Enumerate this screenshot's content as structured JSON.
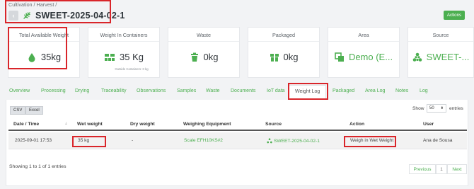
{
  "breadcrumb": "Cultivation / Harvest /",
  "back_icon": "chevron-left-icon",
  "title_icon": "leaf-icon",
  "title": "SWEET-2025-04-02-1",
  "actions_label": "Actions",
  "colors": {
    "accent": "#4caf50",
    "highlight": "#d9252a"
  },
  "cards": [
    {
      "title": "Total Available Weight",
      "value": "35kg",
      "icon": "drop-icon"
    },
    {
      "title": "Weight In Containers",
      "value": "35 Kg",
      "sub": "Outside Containers: 0 kg",
      "icon": "containers-icon"
    },
    {
      "title": "Waste",
      "value": "0kg",
      "icon": "trash-icon"
    },
    {
      "title": "Packaged",
      "value": "0kg",
      "icon": "package-icon"
    },
    {
      "title": "Area",
      "value": "Demo (E...",
      "icon": "area-icon"
    },
    {
      "title": "Source",
      "value": "SWEET-...",
      "icon": "source-icon"
    }
  ],
  "tabs": [
    "Overview",
    "Processing",
    "Drying",
    "Traceability",
    "Observations",
    "Samples",
    "Waste",
    "Documents",
    "IoT data",
    "Weight Log",
    "Packaged",
    "Area Log",
    "Notes",
    "Log"
  ],
  "active_tab": "Weight Log",
  "toolbar": {
    "csv": "CSV",
    "excel": "Excel",
    "show": "Show",
    "entries_value": "50",
    "entries": "entries"
  },
  "table": {
    "headers": [
      "Date / Time",
      "Wet weight",
      "Dry weight",
      "Weighing Equipment",
      "Source",
      "Action",
      "User"
    ],
    "rows": [
      {
        "date": "2025-09-01 17:53",
        "wet": "35 kg",
        "dry": "-",
        "equipment": "Scale EFH10KS#2",
        "source": "SWEET-2025-04-02-1",
        "action": "Weigh in Wet Weight",
        "user": "Ana de Sousa"
      }
    ]
  },
  "info": "Showing 1 to 1 of 1 entries",
  "pagination": {
    "previous": "Previous",
    "page": "1",
    "next": "Next"
  }
}
